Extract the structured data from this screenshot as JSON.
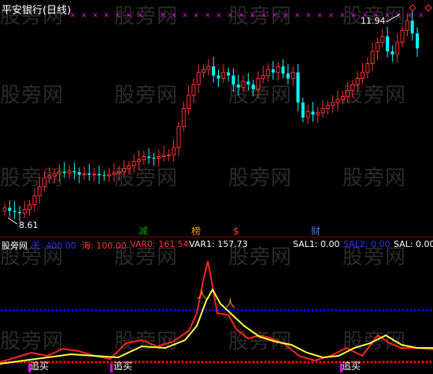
{
  "main": {
    "title": "平安银行(日线)",
    "max_label": "11.94",
    "min_label": "8.61",
    "badges": [
      "减",
      "榜",
      "$",
      "财"
    ]
  },
  "indicator": {
    "name": "股旁网",
    "labels": [
      {
        "text": "天: 400.00",
        "color": "#3333ff"
      },
      {
        "text": "海: 100.00",
        "color": "#ff3333"
      },
      {
        "text": "VAR0: 161.54",
        "color": "#ff3333"
      },
      {
        "text": "VAR1: 157.73",
        "color": "#ffffff"
      },
      {
        "text": "SAL1: 0.00",
        "color": "#ffffff"
      },
      {
        "text": "SAL2: 0.00",
        "color": "#3333ff"
      },
      {
        "text": "SAL: 0.00",
        "color": "#ffffff"
      }
    ],
    "buy_signals": [
      "追买",
      "追买",
      "追买"
    ]
  },
  "watermark": "股旁网",
  "colors": {
    "up": "#ff3333",
    "down": "#00ffff",
    "accent_yellow": "#ffff00",
    "dot_blue": "#0000ff",
    "dot_red": "#ff0000",
    "magenta": "#ff00ff",
    "badge_green": "#00a000",
    "badge_orange": "#ff9900",
    "badge_blue": "#3a7bd5"
  },
  "chart_data": {
    "type": "candlestick",
    "title": "平安银行(日线)",
    "ylim": [
      8.4,
      12.1
    ],
    "closes": [
      8.75,
      8.7,
      8.68,
      8.66,
      8.72,
      8.8,
      8.95,
      9.1,
      9.25,
      9.28,
      9.32,
      9.35,
      9.33,
      9.36,
      9.34,
      9.3,
      9.32,
      9.3,
      9.31,
      9.29,
      9.28,
      9.3,
      9.33,
      9.35,
      9.4,
      9.45,
      9.52,
      9.55,
      9.6,
      9.58,
      9.57,
      9.6,
      9.62,
      9.63,
      9.75,
      10.1,
      10.4,
      10.62,
      10.8,
      11.0,
      11.05,
      11.1,
      10.95,
      10.9,
      11.0,
      10.95,
      10.8,
      10.75,
      10.85,
      10.8,
      10.72,
      10.9,
      10.95,
      11.05,
      11.0,
      11.1,
      10.98,
      10.9,
      11.0,
      10.5,
      10.25,
      10.35,
      10.3,
      10.33,
      10.4,
      10.45,
      10.5,
      10.55,
      10.6,
      10.7,
      10.8,
      10.9,
      11.0,
      11.15,
      11.35,
      11.5,
      11.6,
      11.35,
      11.3,
      11.5,
      11.7,
      11.86,
      11.65,
      11.4
    ]
  }
}
